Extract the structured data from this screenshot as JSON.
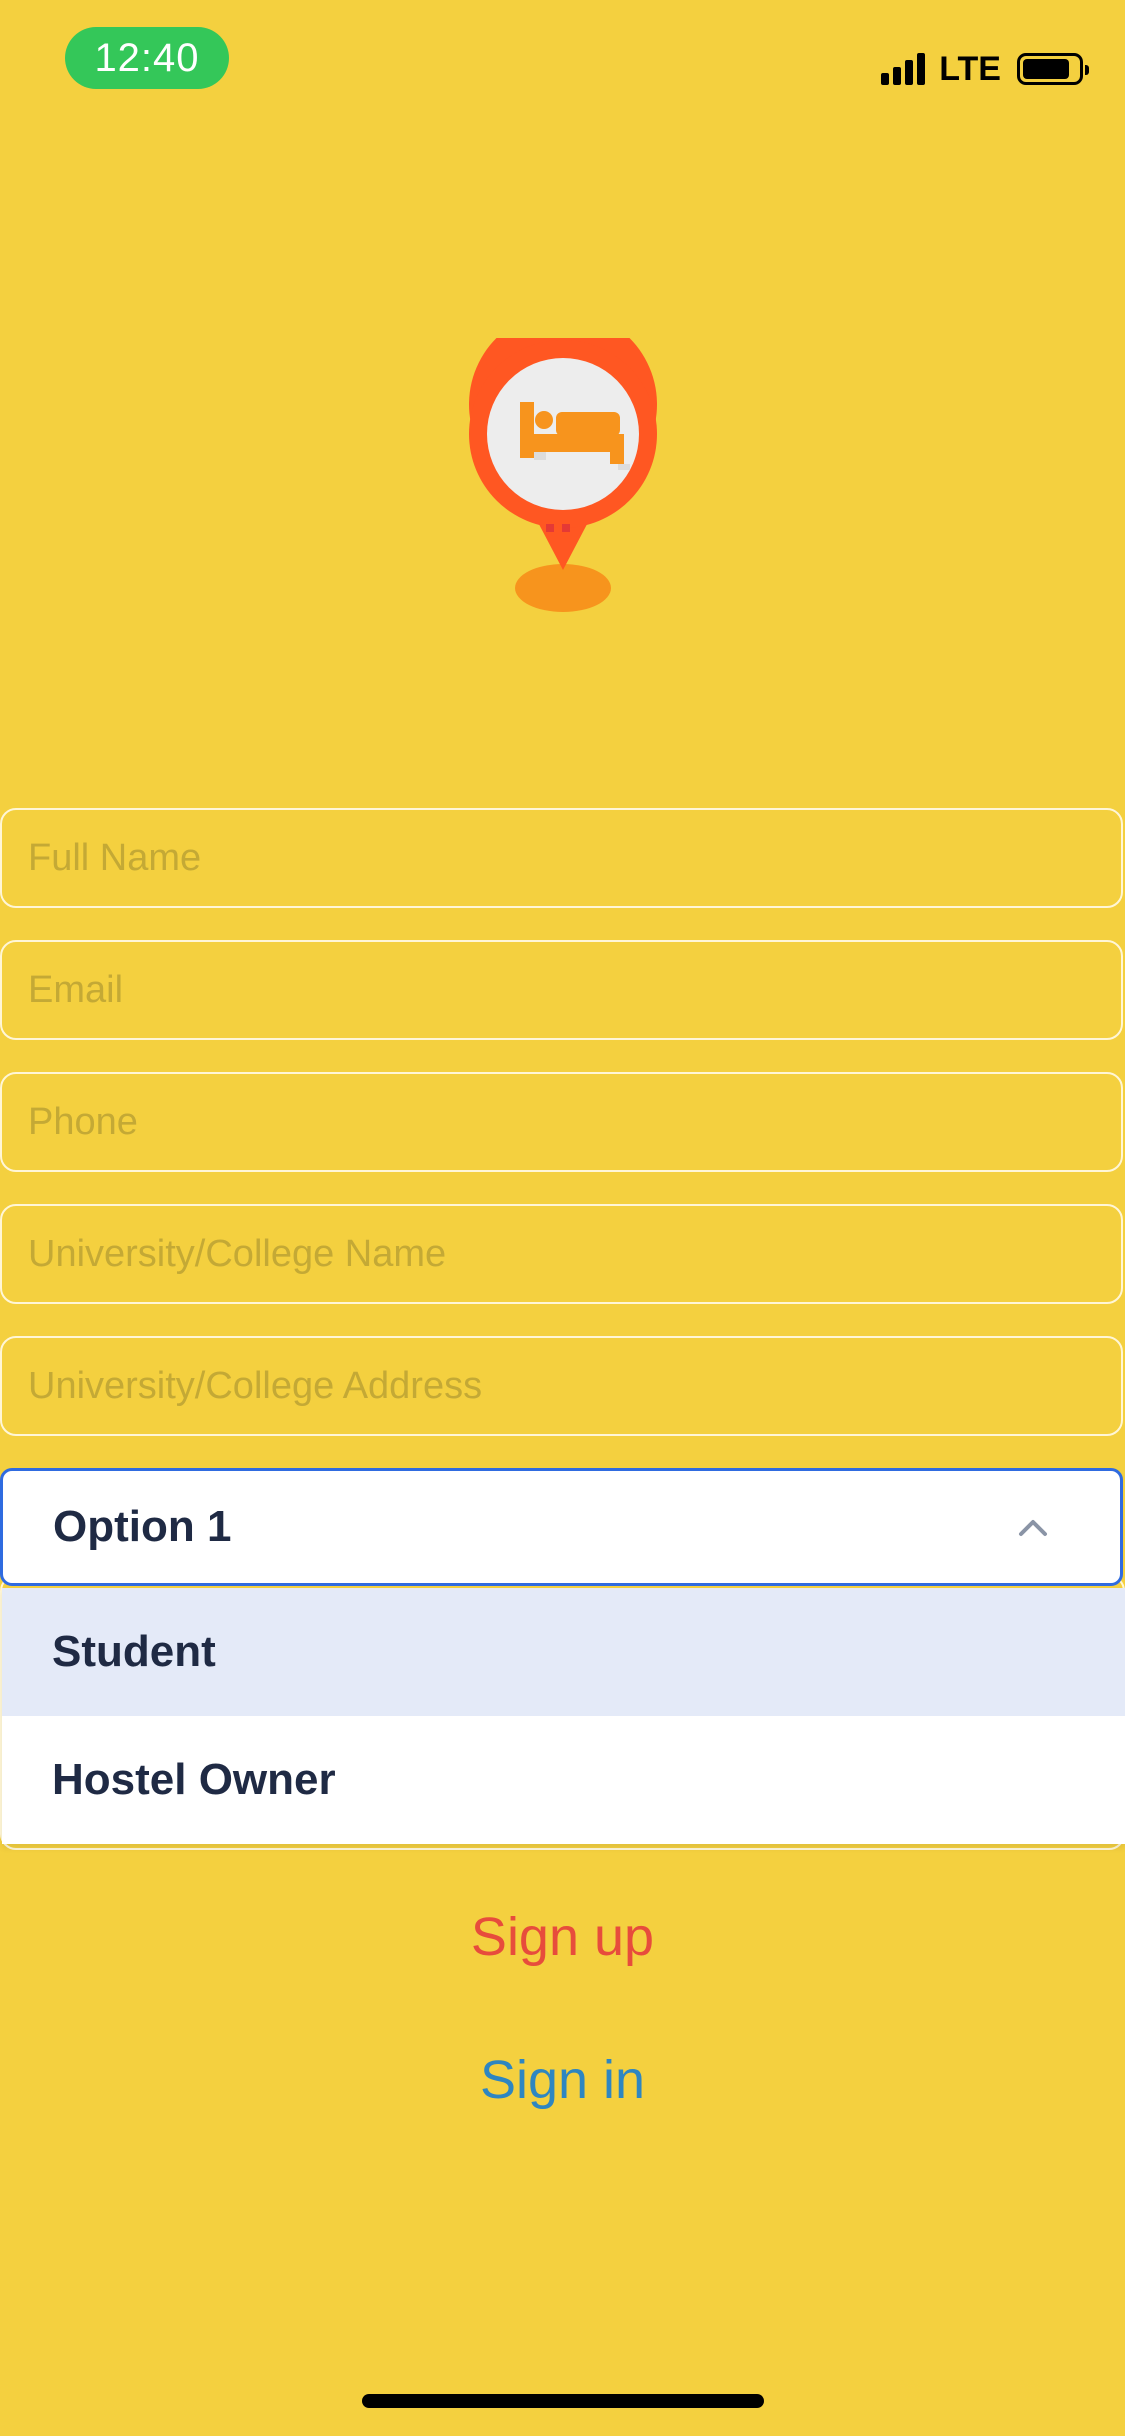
{
  "status_bar": {
    "time": "12:40",
    "network": "LTE",
    "signal_bars": 4,
    "battery_level": 0.85,
    "time_pill_color": "#34C759"
  },
  "logo": {
    "icon": "hostel-location-pin-icon"
  },
  "form": {
    "full_name": {
      "value": "",
      "placeholder": "Full Name"
    },
    "email": {
      "value": "",
      "placeholder": "Email"
    },
    "phone": {
      "value": "",
      "placeholder": "Phone"
    },
    "university_name": {
      "value": "",
      "placeholder": "University/College Name"
    },
    "university_address": {
      "value": "",
      "placeholder": "University/College Address"
    },
    "role_select": {
      "selected": "Option 1",
      "expanded": true,
      "highlighted_index": 0,
      "options": [
        "Student",
        "Hostel Owner"
      ]
    }
  },
  "actions": {
    "signup_label": "Sign up",
    "signin_label": "Sign in"
  },
  "colors": {
    "background": "#F4D03F",
    "field_border": "#FFF6D6",
    "placeholder": "#C4A935",
    "select_border": "#2F6BE0",
    "signup": "#E74C3C",
    "signin": "#2E86C1",
    "option_highlight": "#E4EAF8",
    "option_text": "#1F2A44"
  }
}
